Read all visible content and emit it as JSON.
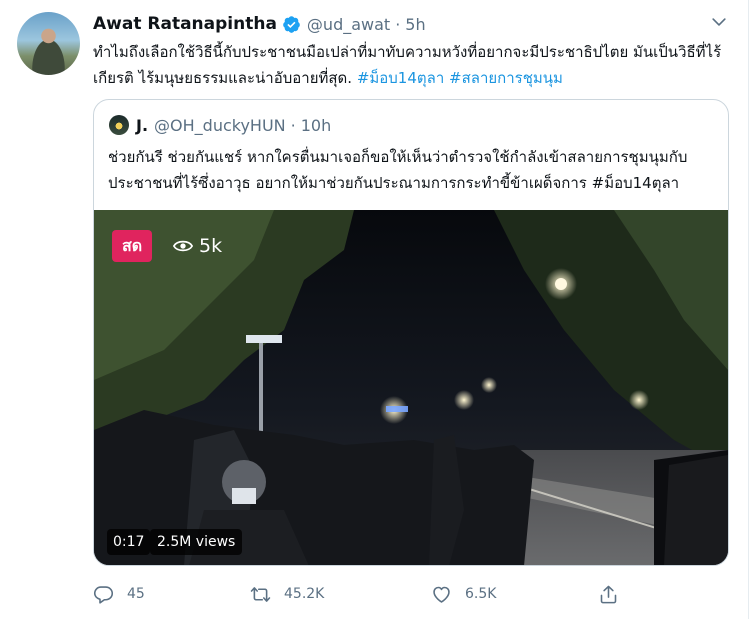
{
  "tweet": {
    "display_name": "Awat Ratanapintha",
    "handle": "@ud_awat",
    "separator": "·",
    "time": "5h",
    "text_part1": "ทำไมถึงเลือกใช้วิธีนี้กับประชาชนมือเปล่าที่มาทับความหวังที่อยากจะมีประชาธิปไตย มันเป็นวิธีที่ไร้เกียรติ ไร้มนุษยธรรมและน่าอับอายที่สุด. ",
    "hashtag1": "#ม็อบ14ตุลา",
    "hashtag2": "#สลายการชุมนุม"
  },
  "quoted": {
    "display_name": "J.",
    "handle": "@OH_duckyHUN",
    "separator": "·",
    "time": "10h",
    "text": "ช่วยกันรี ช่วยกันแชร์ หากใครตื่นมาเจอก็ขอให้เห็นว่าตำรวจใช้กำลังเข้าสลายการชุมนุมกับประชาชนที่ไร้ซึ่งอาวุธ อยากให้มาช่วยกันประณามการกระทำขี้ข้าเผด็จการ #ม็อบ14ตุลา",
    "media": {
      "live_badge": "สด",
      "live_viewers": "5k",
      "duration": "0:17",
      "views": "2.5M views"
    }
  },
  "actions": {
    "replies": "45",
    "retweets": "45.2K",
    "likes": "6.5K"
  },
  "colors": {
    "link": "#1b95e0",
    "secondary_text": "#5b7083",
    "live_badge": "#e0245e",
    "verified": "#1da1f2"
  },
  "icons": [
    "caret-down-icon",
    "verified-badge-icon",
    "eye-icon",
    "reply-icon",
    "retweet-icon",
    "like-icon",
    "share-icon"
  ]
}
